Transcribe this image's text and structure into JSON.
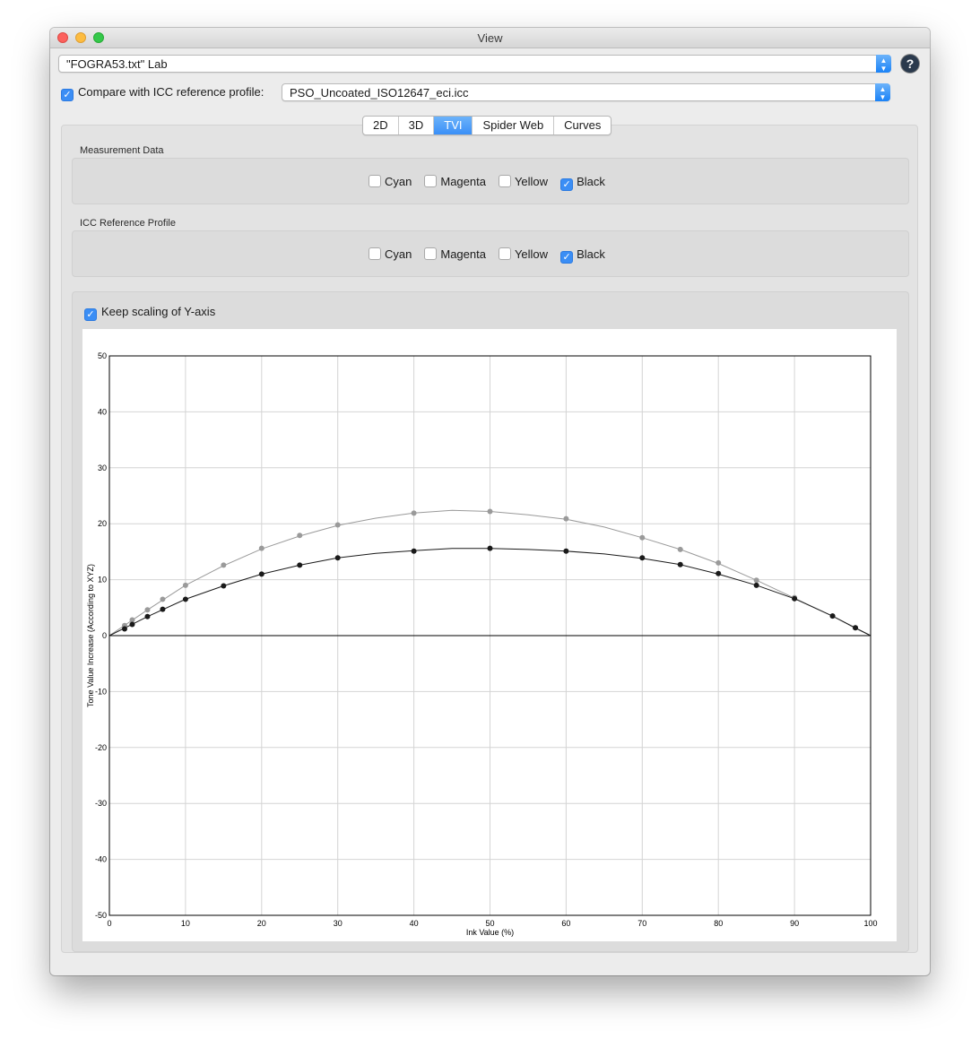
{
  "window": {
    "title": "View"
  },
  "source_popup": {
    "value": "\"FOGRA53.txt\" Lab"
  },
  "help_label": "?",
  "compare": {
    "checked": true,
    "label": "Compare with ICC reference profile:",
    "profile": "PSO_Uncoated_ISO12647_eci.icc"
  },
  "tabs": [
    {
      "label": "2D",
      "selected": false
    },
    {
      "label": "3D",
      "selected": false
    },
    {
      "label": "TVI",
      "selected": true
    },
    {
      "label": "Spider Web",
      "selected": false
    },
    {
      "label": "Curves",
      "selected": false
    }
  ],
  "measurement": {
    "title": "Measurement Data",
    "options": [
      {
        "label": "Cyan",
        "checked": false
      },
      {
        "label": "Magenta",
        "checked": false
      },
      {
        "label": "Yellow",
        "checked": false
      },
      {
        "label": "Black",
        "checked": true
      }
    ]
  },
  "reference": {
    "title": "ICC Reference Profile",
    "options": [
      {
        "label": "Cyan",
        "checked": false
      },
      {
        "label": "Magenta",
        "checked": false
      },
      {
        "label": "Yellow",
        "checked": false
      },
      {
        "label": "Black",
        "checked": true
      }
    ]
  },
  "keep_scaling": {
    "label": "Keep scaling of Y-axis",
    "checked": true
  },
  "chart_data": {
    "type": "line",
    "xlabel": "Ink Value (%)",
    "ylabel": "Tone Value Increase (According to XYZ)",
    "xlim": [
      0,
      100
    ],
    "ylim": [
      -50,
      50
    ],
    "xticks": [
      0,
      10,
      20,
      30,
      40,
      50,
      60,
      70,
      80,
      90,
      100
    ],
    "yticks": [
      -50,
      -40,
      -30,
      -20,
      -10,
      0,
      10,
      20,
      30,
      40,
      50
    ],
    "grid": true,
    "series": [
      {
        "color": "#9a9a9a",
        "points": [
          [
            2,
            1.8
          ],
          [
            3,
            2.8
          ],
          [
            5,
            4.6
          ],
          [
            7,
            6.5
          ],
          [
            10,
            9.0
          ],
          [
            15,
            12.6
          ],
          [
            20,
            15.6
          ],
          [
            25,
            17.9
          ],
          [
            30,
            19.8
          ],
          [
            40,
            21.9
          ],
          [
            50,
            22.2
          ],
          [
            60,
            20.9
          ],
          [
            70,
            17.5
          ],
          [
            75,
            15.4
          ],
          [
            80,
            13.0
          ],
          [
            85,
            9.9
          ],
          [
            90,
            6.8
          ],
          [
            95,
            3.5
          ],
          [
            98,
            1.4
          ]
        ],
        "curve": [
          [
            0,
            0
          ],
          [
            5,
            4.6
          ],
          [
            10,
            9.0
          ],
          [
            15,
            12.5
          ],
          [
            20,
            15.5
          ],
          [
            25,
            17.8
          ],
          [
            30,
            19.7
          ],
          [
            35,
            21.0
          ],
          [
            40,
            21.9
          ],
          [
            45,
            22.4
          ],
          [
            50,
            22.2
          ],
          [
            55,
            21.6
          ],
          [
            60,
            20.8
          ],
          [
            65,
            19.4
          ],
          [
            70,
            17.5
          ],
          [
            75,
            15.4
          ],
          [
            80,
            12.9
          ],
          [
            85,
            9.9
          ],
          [
            90,
            6.7
          ],
          [
            95,
            3.5
          ],
          [
            98,
            1.3
          ],
          [
            100,
            0
          ]
        ]
      },
      {
        "color": "#1a1a1a",
        "points": [
          [
            2,
            1.2
          ],
          [
            3,
            2.0
          ],
          [
            5,
            3.4
          ],
          [
            7,
            4.7
          ],
          [
            10,
            6.5
          ],
          [
            15,
            8.9
          ],
          [
            20,
            11.0
          ],
          [
            25,
            12.6
          ],
          [
            30,
            13.9
          ],
          [
            40,
            15.1
          ],
          [
            50,
            15.6
          ],
          [
            60,
            15.1
          ],
          [
            70,
            13.9
          ],
          [
            75,
            12.7
          ],
          [
            80,
            11.1
          ],
          [
            85,
            9.0
          ],
          [
            90,
            6.6
          ],
          [
            95,
            3.5
          ],
          [
            98,
            1.4
          ]
        ],
        "curve": [
          [
            0,
            0
          ],
          [
            5,
            3.4
          ],
          [
            10,
            6.5
          ],
          [
            15,
            8.9
          ],
          [
            20,
            11.0
          ],
          [
            25,
            12.6
          ],
          [
            30,
            13.9
          ],
          [
            35,
            14.7
          ],
          [
            40,
            15.2
          ],
          [
            45,
            15.6
          ],
          [
            50,
            15.6
          ],
          [
            55,
            15.4
          ],
          [
            60,
            15.1
          ],
          [
            65,
            14.6
          ],
          [
            70,
            13.8
          ],
          [
            75,
            12.7
          ],
          [
            80,
            11.0
          ],
          [
            85,
            9.0
          ],
          [
            90,
            6.6
          ],
          [
            95,
            3.5
          ],
          [
            98,
            1.4
          ],
          [
            100,
            0
          ]
        ]
      }
    ]
  }
}
